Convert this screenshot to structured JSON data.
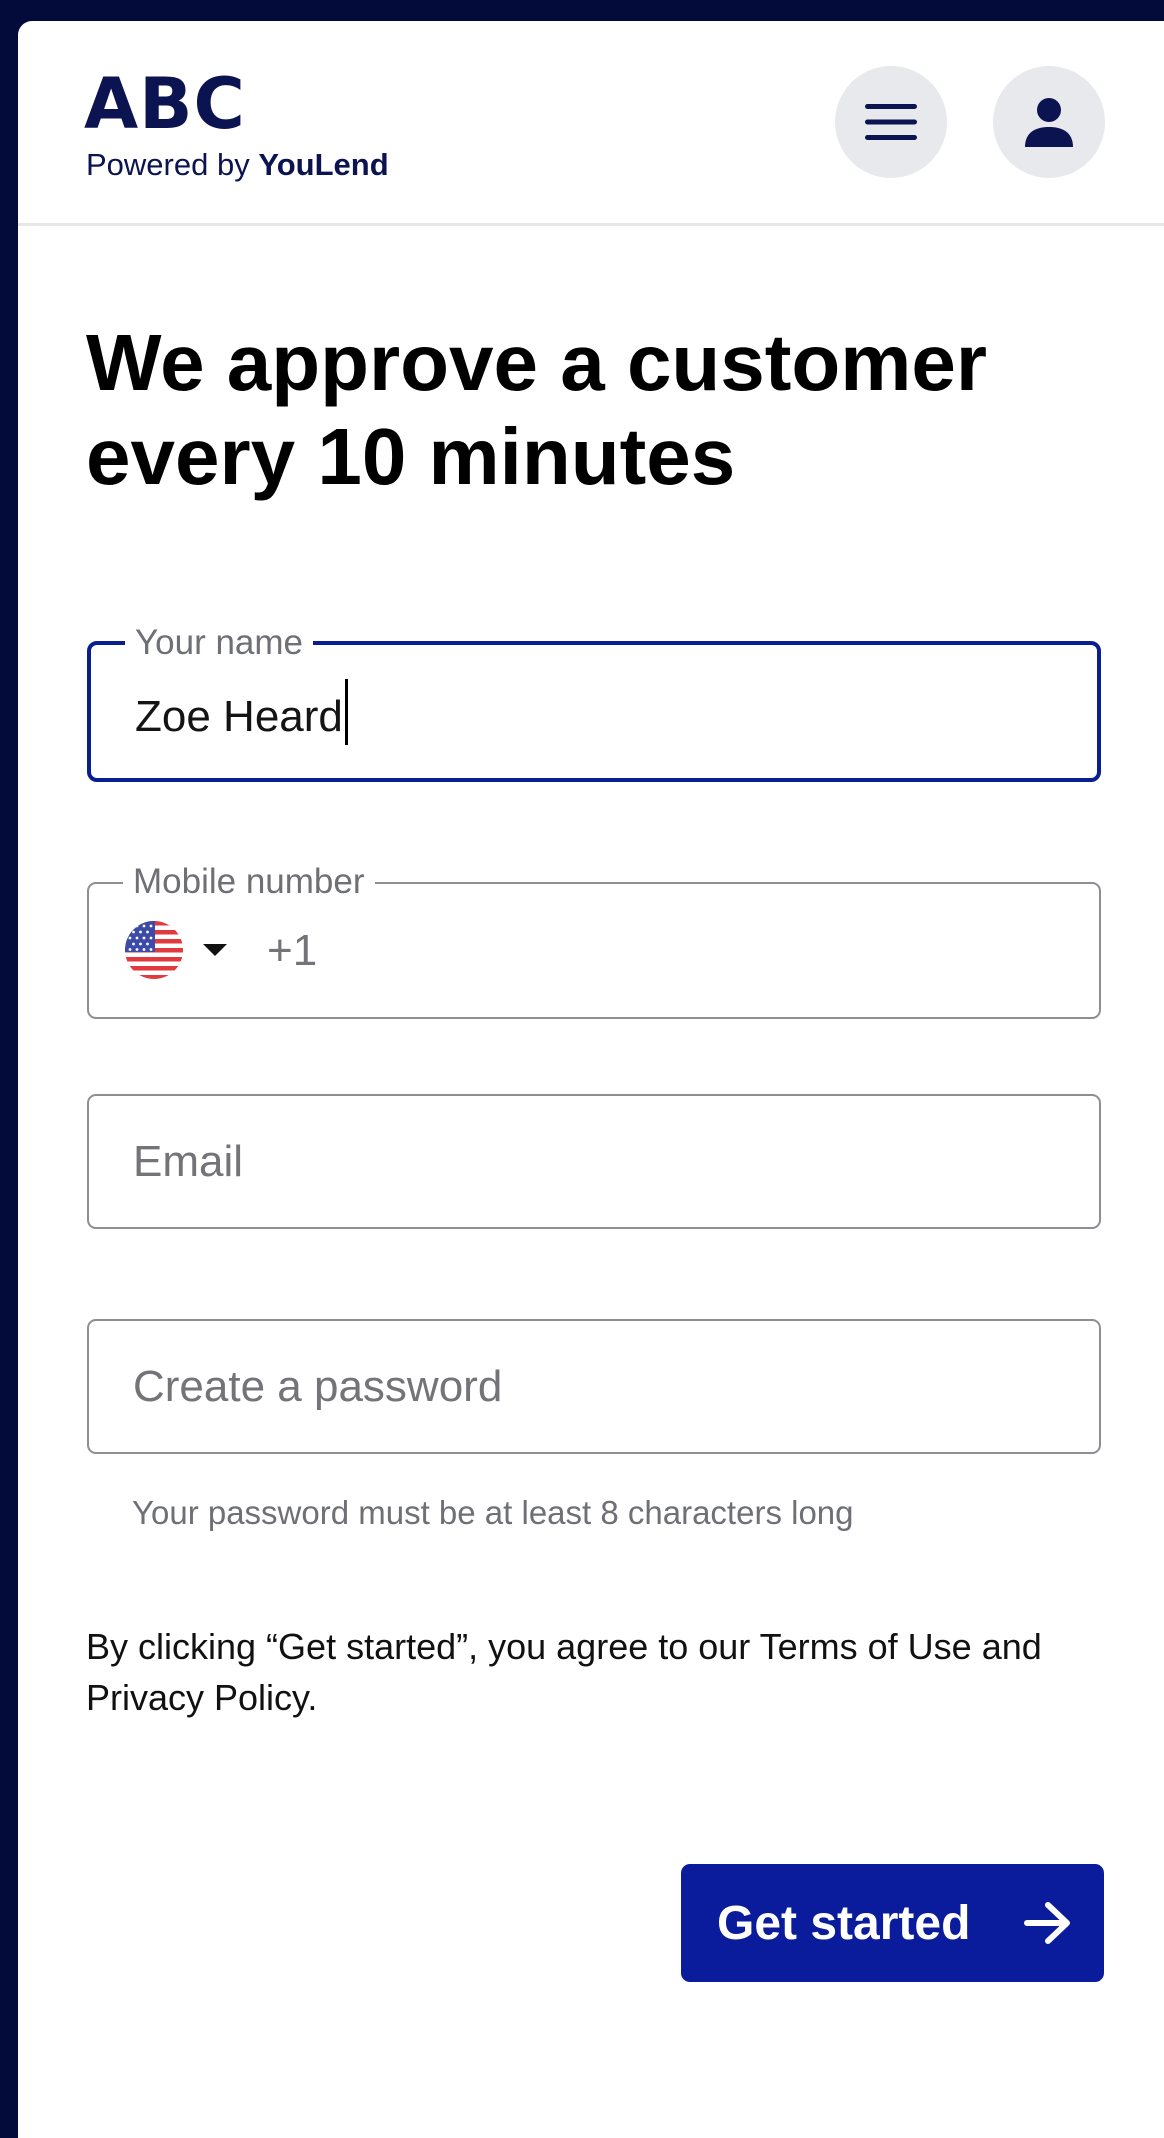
{
  "header": {
    "logo_text": "ABC",
    "powered_by_prefix": "Powered by",
    "powered_by_brand": "YouLend",
    "menu_icon": "hamburger-menu-icon",
    "account_icon": "user-account-icon"
  },
  "main": {
    "headline": "We approve a customer every 10 minutes",
    "fields": {
      "name": {
        "label": "Your name",
        "value": "Zoe Heard"
      },
      "mobile": {
        "label": "Mobile number",
        "country_flag": "us-flag-icon",
        "dial_code": "+1",
        "value": ""
      },
      "email": {
        "placeholder": "Email",
        "value": ""
      },
      "password": {
        "placeholder": "Create a password",
        "value": "",
        "helper": "Your password must be at least 8 characters long"
      }
    },
    "terms_text": "By clicking “Get started”, you agree to our Terms of Use and Privacy Policy.",
    "cta": {
      "label": "Get started",
      "icon": "arrow-right-icon"
    }
  },
  "colors": {
    "frame_background": "#020b3a",
    "brand_navy": "#0b1450",
    "focus_blue": "#0a1f8f",
    "button_blue": "#0a1c9c",
    "field_border": "#8e8e93",
    "icon_button_bg": "#e8e9ed"
  }
}
